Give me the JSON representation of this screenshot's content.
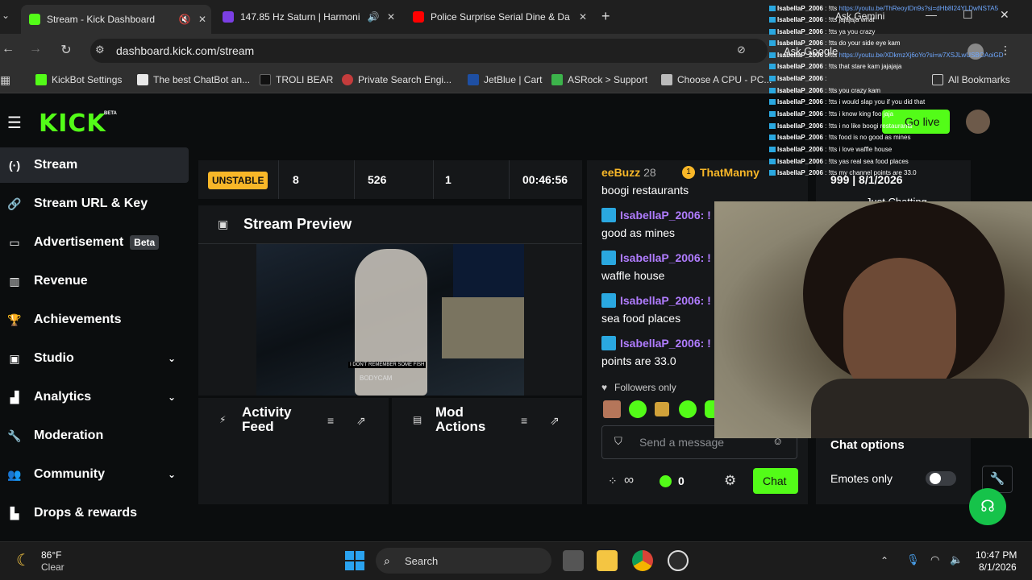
{
  "browser": {
    "tabs": [
      {
        "title": "Stream - Kick Dashboard"
      },
      {
        "title": "147.85 Hz Saturn | Harmoni"
      },
      {
        "title": "Police Surprise Serial Dine & Da"
      }
    ],
    "url": "dashboard.kick.com/stream",
    "bookmarks": [
      "KickBot Settings",
      "The best ChatBot an...",
      "TROLI BEAR",
      "Private Search Engi...",
      "JetBlue | Cart",
      "ASRock > Support",
      "Choose A CPU - PC..."
    ],
    "all_bookmarks": "All Bookmarks",
    "ask_gemini": "Ask Gemini",
    "ask_google": "Ask Google"
  },
  "header": {
    "logo": "KICK",
    "logo_badge": "BETA",
    "go_live": "Go live"
  },
  "sidebar": {
    "items": [
      {
        "label": "Stream",
        "icon": "broadcast-icon"
      },
      {
        "label": "Stream URL & Key",
        "icon": "link-icon"
      },
      {
        "label": "Advertisement",
        "icon": "ad-icon",
        "badge": "Beta"
      },
      {
        "label": "Revenue",
        "icon": "chart-icon"
      },
      {
        "label": "Achievements",
        "icon": "trophy-icon"
      },
      {
        "label": "Studio",
        "icon": "studio-icon"
      },
      {
        "label": "Analytics",
        "icon": "analytics-icon"
      },
      {
        "label": "Moderation",
        "icon": "wrench-icon"
      },
      {
        "label": "Community",
        "icon": "community-icon"
      },
      {
        "label": "Drops & rewards",
        "icon": "drops-icon"
      }
    ]
  },
  "stats": {
    "status": "UNSTABLE",
    "viewers": "8",
    "followers": "526",
    "subs": "1",
    "uptime": "00:46:56"
  },
  "preview": {
    "title": "Stream Preview",
    "caption": "I DON'T REMEMBER SOME FISH",
    "watermark": "BODYCAM"
  },
  "activity": {
    "title": "Activity Feed"
  },
  "mod": {
    "title": "Mod Actions"
  },
  "chat": {
    "top_users": [
      {
        "name": "eeBuzz",
        "count": "28"
      },
      {
        "name": "ThatManny"
      }
    ],
    "messages": [
      {
        "text": "boogi restaurants"
      },
      {
        "user": "IsabellaP_2006: !",
        "text": "good as mines"
      },
      {
        "user": "IsabellaP_2006: !",
        "text": "waffle house"
      },
      {
        "user": "IsabellaP_2006: !",
        "text": "sea food places"
      },
      {
        "user": "IsabellaP_2006: !",
        "text": "points are 33.0"
      }
    ],
    "followers_only": "Followers only",
    "placeholder": "Send a message",
    "infinity": "∞",
    "points": "0",
    "send": "Chat"
  },
  "side_panel": {
    "stream_info": "999 | 8/1/2026",
    "category": "Just Chatting",
    "chat_options": "Chat options",
    "emotes_only": "Emotes only",
    "emotes_only_on": false
  },
  "overlay_log": [
    {
      "user": "IsabellaP_2006",
      "msg": "!tts",
      "url": "https://youtu.be/ThReoyIDn9s?si=dHb8I24YLDwNSTA5"
    },
    {
      "user": "IsabellaP_2006",
      "msg": "!tts jajajaja what"
    },
    {
      "user": "IsabellaP_2006",
      "msg": "!tts ya you crazy"
    },
    {
      "user": "IsabellaP_2006",
      "msg": "!tts do your side eye kam"
    },
    {
      "user": "IsabellaP_2006",
      "msg": "!tts",
      "url": "https://youtu.be/XDkmzXj6oYo?si=w7XSJLwUSBOAoiGD"
    },
    {
      "user": "IsabellaP_2006",
      "msg": "!tts that stare kam jajajaja"
    },
    {
      "user": "IsabellaP_2006",
      "msg": ""
    },
    {
      "user": "IsabellaP_2006",
      "msg": "!tts you crazy kam"
    },
    {
      "user": "IsabellaP_2006",
      "msg": "!tts i would slap you if you did that"
    },
    {
      "user": "IsabellaP_2006",
      "msg": "!tts i know king foo jaja"
    },
    {
      "user": "IsabellaP_2006",
      "msg": "!tts i no like boogi restaurants"
    },
    {
      "user": "IsabellaP_2006",
      "msg": "!tts food is no good as mines"
    },
    {
      "user": "IsabellaP_2006",
      "msg": "!tts i love waffle house"
    },
    {
      "user": "IsabellaP_2006",
      "msg": "!tts yas real sea food places"
    },
    {
      "user": "IsabellaP_2006",
      "msg": "!tts my channel points are 33.0"
    }
  ],
  "taskbar": {
    "weather_temp": "86°F",
    "weather_desc": "Clear",
    "search": "Search",
    "time": "10:47 PM",
    "date": "8/1/2026"
  },
  "colors": {
    "kick_green": "#53fc18",
    "unstable": "#f8b728",
    "chat_user": "#b07cff"
  }
}
